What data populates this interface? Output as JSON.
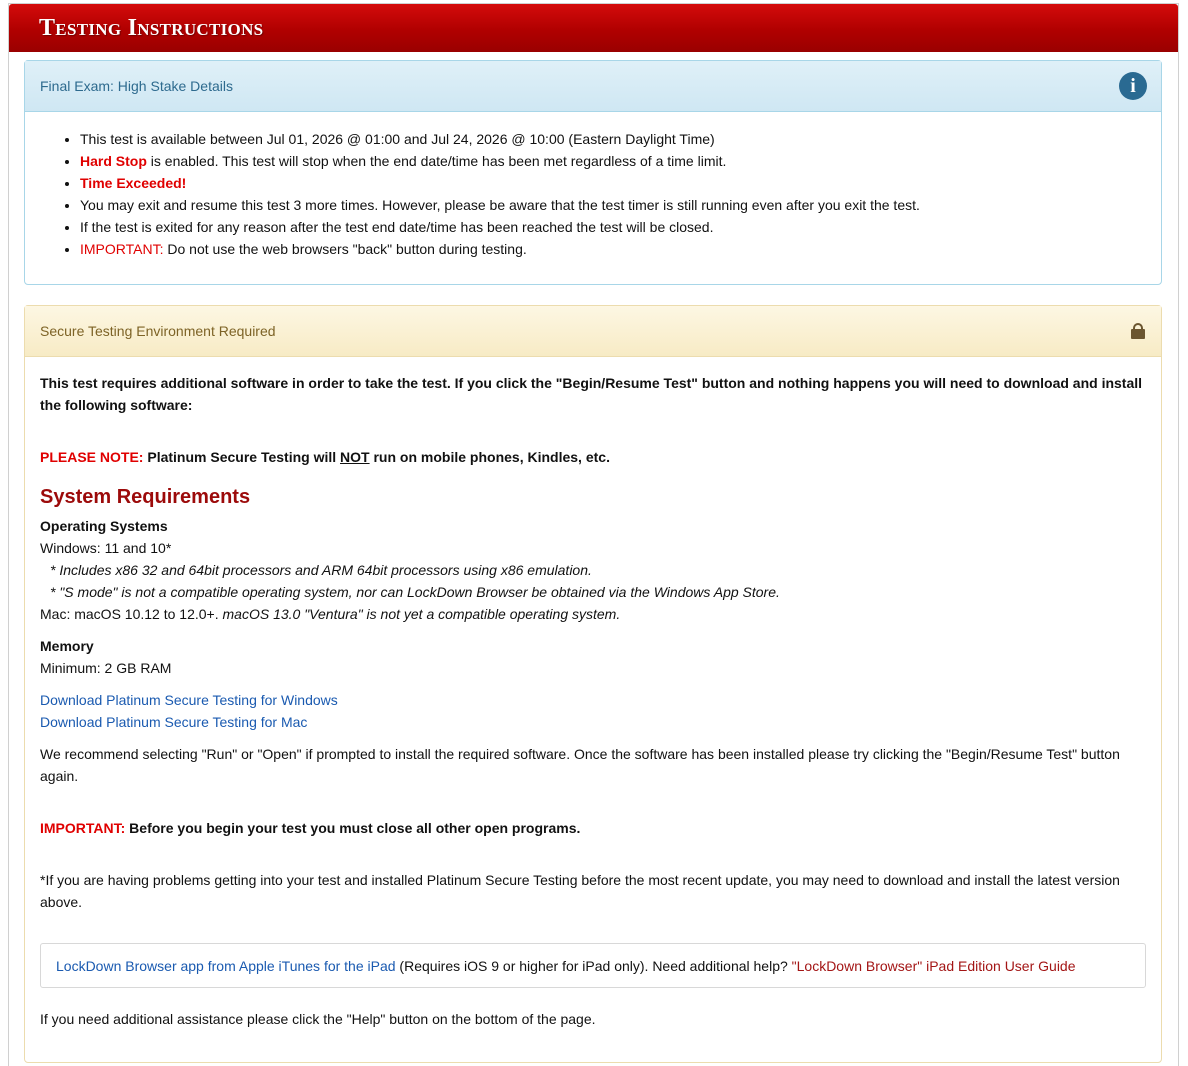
{
  "header": {
    "title": "Testing Instructions"
  },
  "details_panel": {
    "title": "Final Exam: High Stake Details",
    "icon": "info-circle-icon",
    "items": [
      {
        "text": "This test is available between Jul 01, 2026 @ 01:00 and Jul 24, 2026 @ 10:00 (Eastern Daylight Time)"
      },
      {
        "highlight": "Hard Stop",
        "text": " is enabled. This test will stop when the end date/time has been met regardless of a time limit."
      },
      {
        "highlight": "Time Exceeded!"
      },
      {
        "text": "You may exit and resume this test 3 more times. However, please be aware that the test timer is still running even after you exit the test."
      },
      {
        "text": "If the test is exited for any reason after the test end date/time has been reached the test will be closed."
      },
      {
        "label": "IMPORTANT:",
        "text": " Do not use the web browsers \"back\" button during testing."
      }
    ]
  },
  "secure_panel": {
    "title": "Secure Testing Environment Required",
    "icon": "lock-icon",
    "intro": "This test requires additional software in order to take the test. If you click the \"Begin/Resume Test\" button and nothing happens you will need to download and install the following software:",
    "note": {
      "label": "PLEASE NOTE:",
      "text_before": " Platinum Secure Testing will ",
      "emphasis": "NOT",
      "text_after": " run on mobile phones, Kindles, etc."
    },
    "requirements_title": "System Requirements",
    "os": {
      "heading": "Operating Systems",
      "windows": "Windows: 11 and 10*",
      "notes": [
        "* Includes x86 32 and 64bit processors and ARM 64bit processors using x86 emulation.",
        "* \"S mode\" is not a compatible operating system, nor can LockDown Browser be obtained via the Windows App Store."
      ],
      "mac": "Mac: macOS 10.12 to 12.0+. ",
      "mac_note": "macOS 13.0 \"Ventura\" is not yet a compatible operating system."
    },
    "memory": {
      "heading": "Memory",
      "value": "Minimum: 2 GB RAM"
    },
    "downloads": {
      "windows": "Download Platinum Secure Testing for Windows",
      "mac": "Download Platinum Secure Testing for Mac"
    },
    "recommend": "We recommend selecting \"Run\" or \"Open\" if prompted to install the required software. Once the software has been installed please try clicking the \"Begin/Resume Test\" button again.",
    "important": {
      "label": "IMPORTANT:",
      "text": " Before you begin your test you must close all other open programs."
    },
    "problems": "*If you are having problems getting into your test and installed Platinum Secure Testing before the most recent update, you may need to download and install the latest version above.",
    "ipad": {
      "link": "LockDown Browser app from Apple iTunes for the iPad",
      "text": " (Requires iOS 9 or higher for iPad only). Need additional help? ",
      "guide": "\"LockDown Browser\" iPad Edition User Guide"
    },
    "help": "If you need additional assistance please click the \"Help\" button on the bottom of the page."
  },
  "colors": {
    "header_red": "#b00000",
    "alert_red": "#e00000",
    "title_red": "#9c0a0a",
    "link_blue": "#1a5ab0",
    "info_blue": "#2a6a92"
  }
}
